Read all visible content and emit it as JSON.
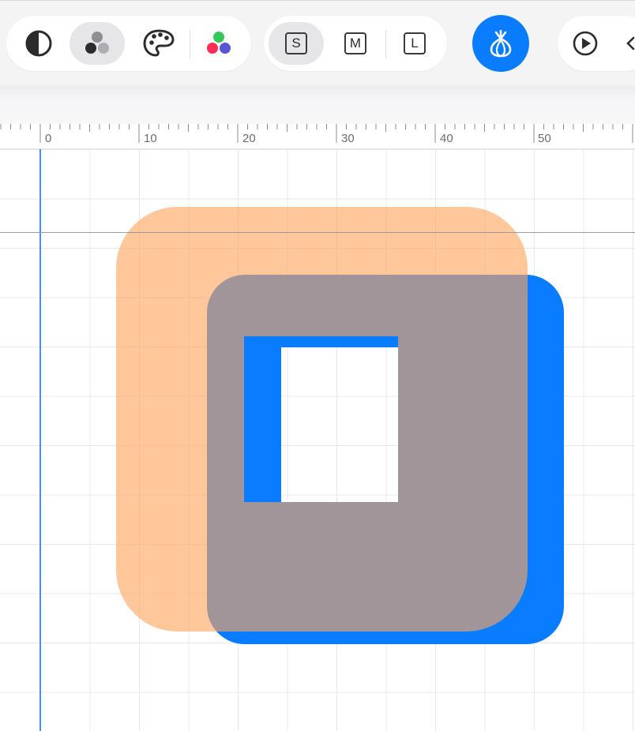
{
  "toolbar": {
    "groups": [
      {
        "name": "view-mode",
        "buttons": [
          {
            "id": "contrast",
            "icon": "contrast-icon",
            "active": false
          },
          {
            "id": "shapes",
            "icon": "shapes-icon",
            "active": true
          },
          {
            "id": "palette",
            "icon": "palette-icon",
            "active": false
          },
          {
            "id": "rgb",
            "icon": "rgb-dots-icon",
            "active": false
          }
        ]
      },
      {
        "name": "size",
        "buttons": [
          {
            "id": "size-s",
            "label": "S",
            "active": true
          },
          {
            "id": "size-m",
            "label": "M",
            "active": false
          },
          {
            "id": "size-l",
            "label": "L",
            "active": false
          }
        ]
      }
    ],
    "onion_skin": {
      "icon": "onion-icon",
      "active": true,
      "color": "#0a7cff"
    },
    "play": {
      "icon": "play-icon"
    }
  },
  "ruler": {
    "labels": [
      "0",
      "10",
      "20",
      "30",
      "40",
      "50"
    ]
  },
  "colors": {
    "onion_fill": "#FFB47A",
    "shape_fill": "#0A7CFF",
    "guide": "#4A8FF0"
  }
}
